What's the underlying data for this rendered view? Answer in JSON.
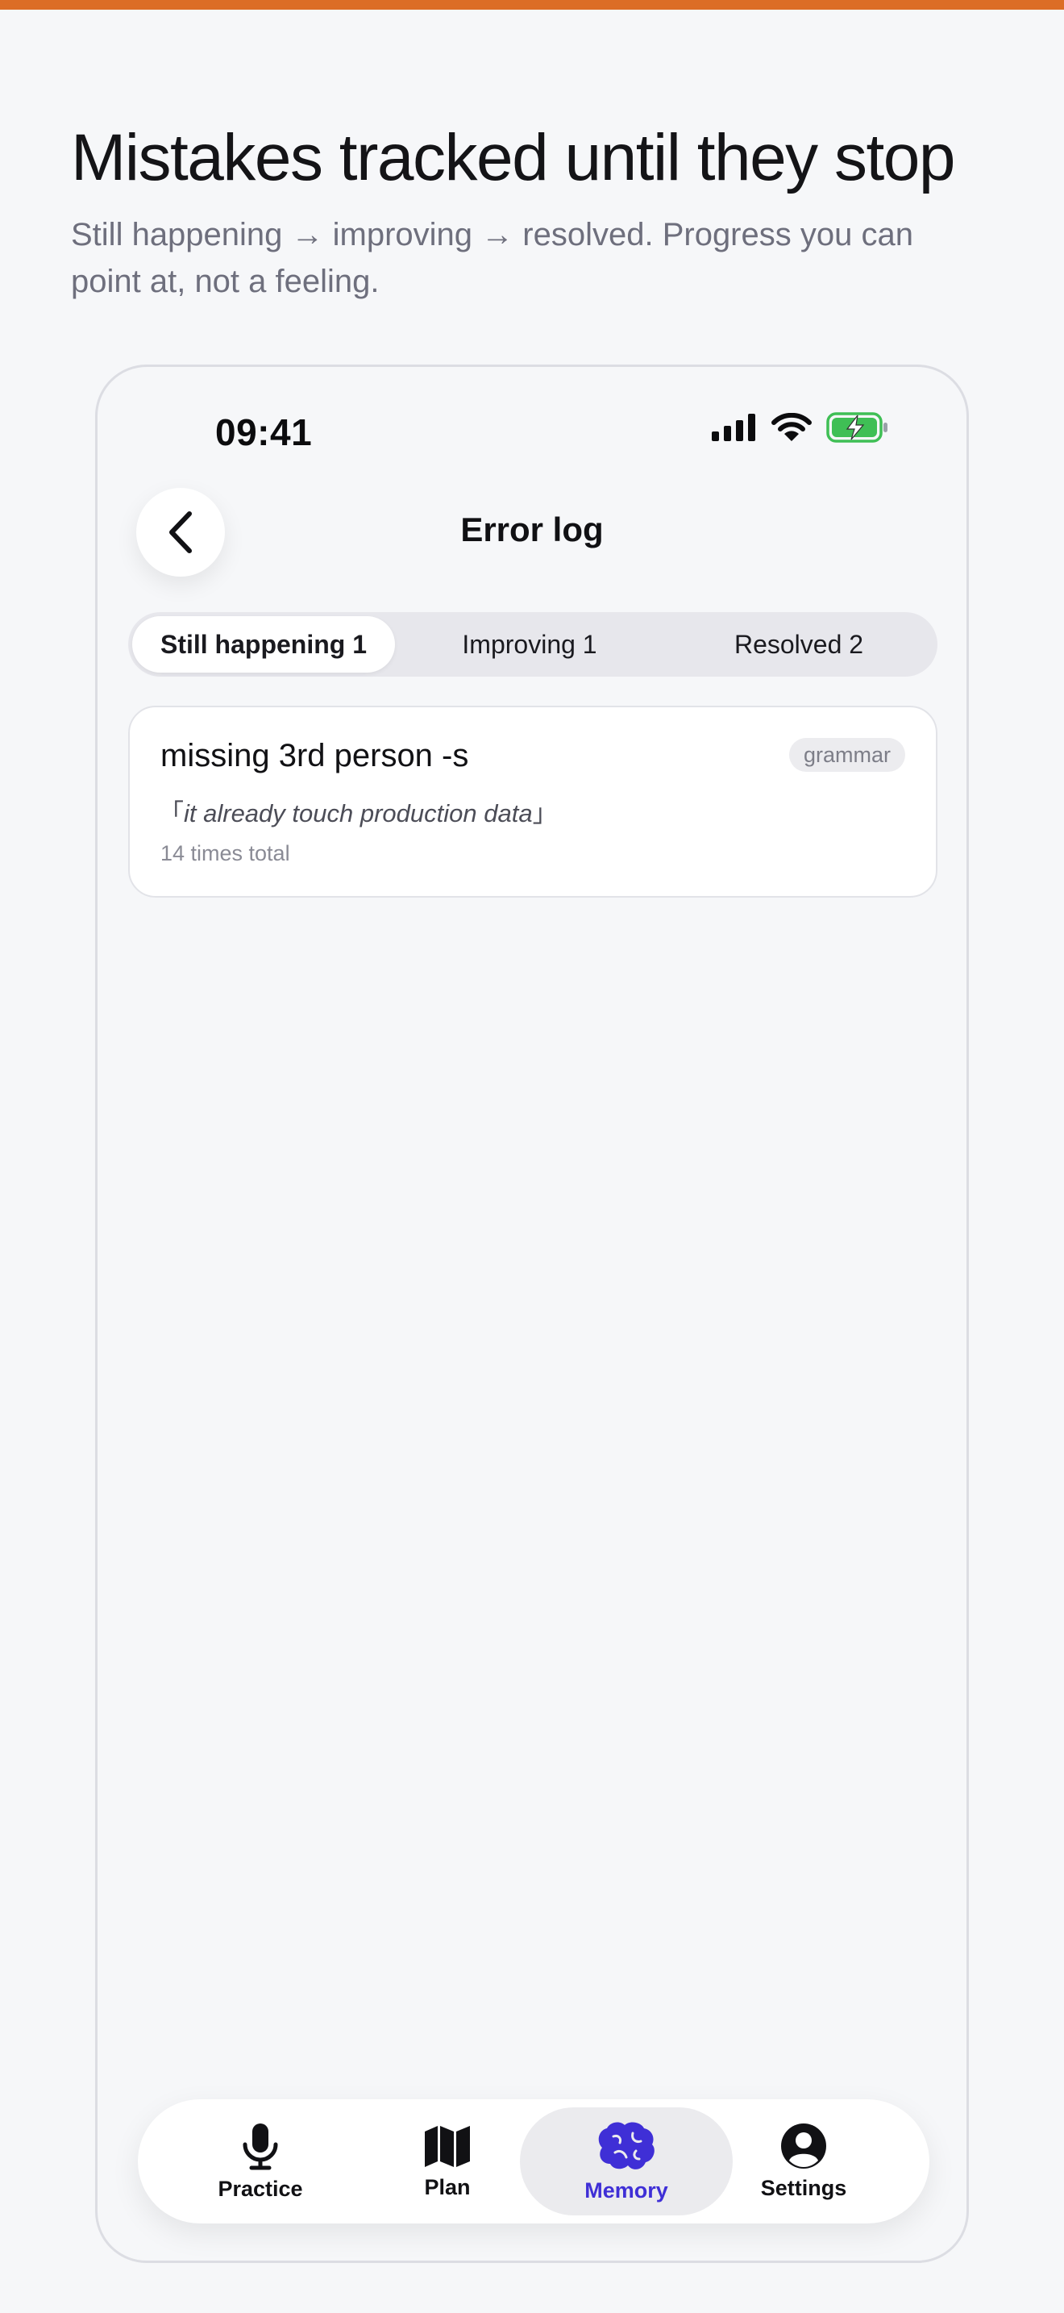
{
  "intro": {
    "headline": "Mistakes tracked until they stop",
    "subline": "Still happening → improving → resolved. Progress you can point at, not a feeling."
  },
  "status_bar": {
    "time": "09:41",
    "icons": [
      "cellular-signal-icon",
      "wifi-icon",
      "battery-charging-icon"
    ]
  },
  "nav": {
    "title": "Error log",
    "back_icon": "chevron-left-icon"
  },
  "segments": [
    {
      "label": "Still happening 1",
      "active": true
    },
    {
      "label": "Improving 1",
      "active": false
    },
    {
      "label": "Resolved 2",
      "active": false
    }
  ],
  "errors": [
    {
      "title": "missing 3rd person -s",
      "tag": "grammar",
      "quote_open": "「",
      "quote": "it already touch production data",
      "quote_close": "」",
      "count": "14 times total"
    }
  ],
  "tabbar": {
    "items": [
      {
        "label": "Practice",
        "icon": "microphone-icon",
        "active": false
      },
      {
        "label": "Plan",
        "icon": "map-icon",
        "active": false
      },
      {
        "label": "Memory",
        "icon": "brain-icon",
        "active": true
      },
      {
        "label": "Settings",
        "icon": "person-circle-icon",
        "active": false
      }
    ]
  },
  "colors": {
    "accent_bar": "#dc6d26",
    "active_tab": "#3f2fd6",
    "battery": "#3fbf55"
  }
}
